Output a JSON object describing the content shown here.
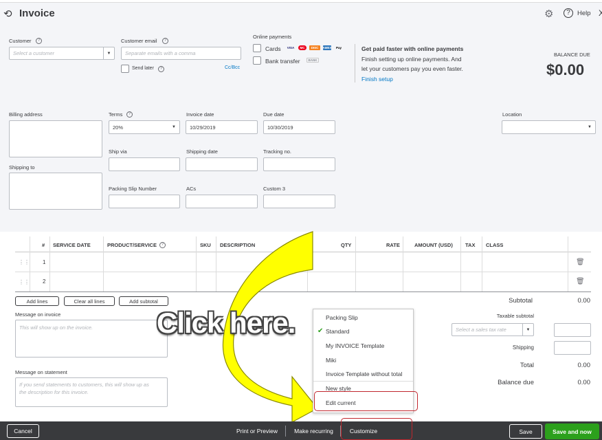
{
  "header": {
    "title": "Invoice",
    "help_label": "Help",
    "close_glyph": "X"
  },
  "customer": {
    "label": "Customer",
    "placeholder": "Select a customer",
    "email_label": "Customer email",
    "email_placeholder": "Separate emails with a comma",
    "send_later_label": "Send later",
    "cc_bcc_label": "Cc/Bcc"
  },
  "online_payments": {
    "label": "Online payments",
    "cards_label": "Cards",
    "bank_transfer_label": "Bank transfer",
    "card_icons": [
      "VISA",
      "MC",
      "DISC",
      "AMEX",
      "Pay"
    ],
    "bank_icon": "BANK",
    "promo_title": "Get paid faster with online payments",
    "promo_line1": "Finish setting up online payments. And",
    "promo_line2": "let your customers pay you even faster.",
    "promo_link": "Finish setup"
  },
  "balance": {
    "label": "BALANCE DUE",
    "amount": "$0.00"
  },
  "fields": {
    "billing_address_label": "Billing address",
    "shipping_to_label": "Shipping to",
    "terms_label": "Terms",
    "terms_value": "20%",
    "invoice_date_label": "Invoice date",
    "invoice_date_value": "10/29/2019",
    "due_date_label": "Due date",
    "due_date_value": "10/30/2019",
    "location_label": "Location",
    "ship_via_label": "Ship via",
    "shipping_date_label": "Shipping date",
    "tracking_label": "Tracking no.",
    "packing_slip_label": "Packing Slip Number",
    "acs_label": "ACs",
    "custom3_label": "Custom 3"
  },
  "table": {
    "headers": [
      "#",
      "SERVICE DATE",
      "PRODUCT/SERVICE",
      "SKU",
      "DESCRIPTION",
      "QTY",
      "RATE",
      "AMOUNT (USD)",
      "TAX",
      "CLASS"
    ],
    "rows": [
      {
        "num": "1"
      },
      {
        "num": "2"
      }
    ],
    "add_lines": "Add lines",
    "clear_all_lines": "Clear all lines",
    "add_subtotal": "Add subtotal"
  },
  "messages": {
    "invoice_label": "Message on invoice",
    "invoice_placeholder": "This will show up on the invoice.",
    "statement_label": "Message on statement",
    "statement_placeholder_line1": "If you send statements to customers, this will show up as",
    "statement_placeholder_line2": "the description for this invoice."
  },
  "totals": {
    "subtotal_label": "Subtotal",
    "subtotal_value": "0.00",
    "taxable_subtotal_label": "Taxable subtotal",
    "tax_rate_placeholder": "Select a sales tax rate",
    "shipping_label": "Shipping",
    "total_label": "Total",
    "total_value": "0.00",
    "balance_due_label": "Balance due",
    "balance_due_value": "0.00"
  },
  "customize_menu": {
    "items": [
      "Packing Slip",
      "Standard",
      "My INVOICE Template",
      "Miki",
      "Invoice Template without total",
      "New style",
      "Edit current"
    ],
    "checked_index": 1
  },
  "callout": {
    "text": "Click here."
  },
  "footer": {
    "cancel": "Cancel",
    "print_preview": "Print or Preview",
    "make_recurring": "Make recurring",
    "customize": "Customize",
    "save": "Save",
    "save_and_new": "Save and now"
  },
  "colors": {
    "footer_bg": "#393a3d",
    "primary_green": "#2ca01c",
    "link_blue": "#0077c5",
    "highlight_red": "#c0262d",
    "arrow_yellow": "#ffff00"
  }
}
